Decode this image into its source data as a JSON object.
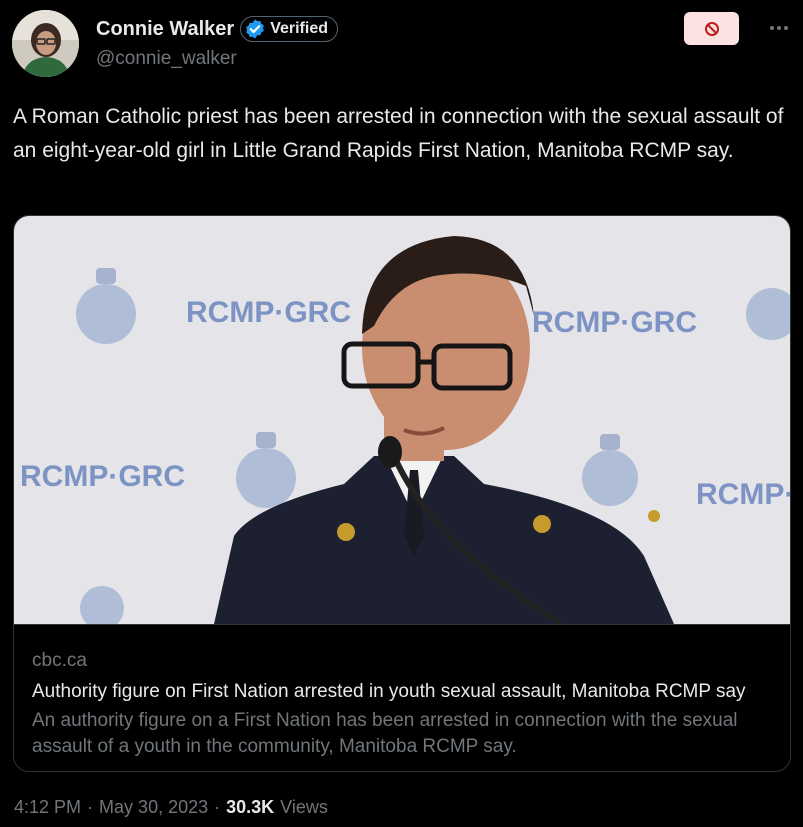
{
  "author": {
    "display_name": "Connie Walker",
    "verified_label": "Verified",
    "handle": "@connie_walker"
  },
  "icons": {
    "avatar": "avatar-photo",
    "verified": "verified-check-icon",
    "block": "block-icon",
    "more": "more-dots-icon"
  },
  "colors": {
    "verified_blue": "#1d9bf0",
    "block_bg": "#fde2e2",
    "block_red": "#c01e1e"
  },
  "tweet": {
    "text": "A Roman Catholic priest has been arrested in connection with the sexual assault of an eight-year-old girl in Little Grand Rapids First Nation, Manitoba RCMP say."
  },
  "card": {
    "image_wall_text": "RCMP·GRC",
    "domain": "cbc.ca",
    "title": "Authority figure on First Nation arrested in youth sexual assault, Manitoba RCMP say",
    "description": "An authority figure on a First Nation has been arrested in connection with the sexual assault of a youth in the community, Manitoba RCMP say."
  },
  "footer": {
    "time": "4:12 PM",
    "separator": "·",
    "date": "May 30, 2023",
    "views_count": "30.3K",
    "views_label": "Views"
  }
}
